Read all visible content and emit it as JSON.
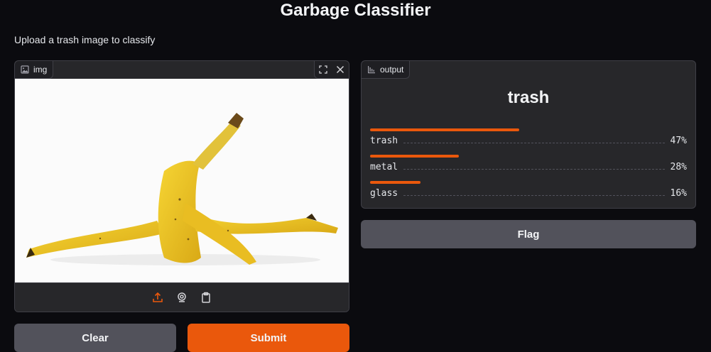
{
  "app": {
    "title": "Garbage Classifier",
    "description": "Upload a trash image to classify"
  },
  "input": {
    "label": "img",
    "label_icon": "image-icon",
    "tools": [
      "fullscreen-icon",
      "close-icon"
    ],
    "sources": [
      "upload-icon",
      "webcam-icon",
      "clipboard-icon"
    ],
    "image_subject": "banana peel"
  },
  "output": {
    "label": "output",
    "label_icon": "bar-chart-icon",
    "predicted": "trash",
    "confidences": [
      {
        "label": "trash",
        "value": 0.47,
        "display": "47%"
      },
      {
        "label": "metal",
        "value": 0.28,
        "display": "28%"
      },
      {
        "label": "glass",
        "value": 0.16,
        "display": "16%"
      }
    ]
  },
  "buttons": {
    "flag": "Flag",
    "clear": "Clear",
    "submit": "Submit"
  },
  "colors": {
    "accent": "#ea580c",
    "background": "#0b0b0f",
    "panel": "#27272a",
    "secondary_button": "#52525b"
  }
}
